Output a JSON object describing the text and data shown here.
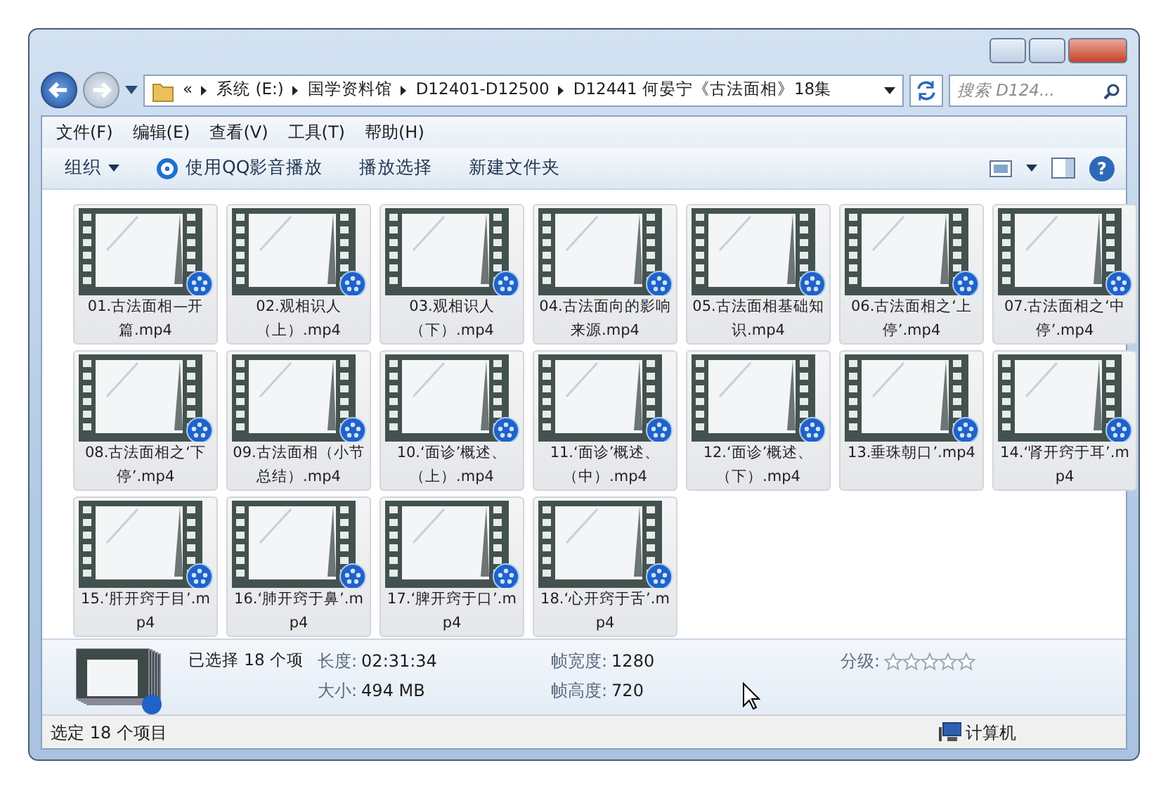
{
  "address": {
    "overflow_mark": "«",
    "segments": [
      "系统 (E:)",
      "国学资料馆",
      "D12401-D12500",
      "D12441 何晏宁《古法面相》18集"
    ]
  },
  "search": {
    "placeholder": "搜索 D124..."
  },
  "menu": [
    "文件(F)",
    "编辑(E)",
    "查看(V)",
    "工具(T)",
    "帮助(H)"
  ],
  "toolbar": [
    {
      "label": "组织",
      "kind": "dropdown"
    },
    {
      "label": "使用QQ影音播放",
      "kind": "app"
    },
    {
      "label": "播放选择",
      "kind": "plain"
    },
    {
      "label": "新建文件夹",
      "kind": "plain"
    }
  ],
  "help_mark": "?",
  "files": [
    {
      "name": "01.古法面相—开篇.mp4",
      "selected": true
    },
    {
      "name": "02.观相识人（上）.mp4",
      "selected": true
    },
    {
      "name": "03.观相识人（下）.mp4",
      "selected": true
    },
    {
      "name": "04.古法面向的影响来源.mp4",
      "selected": true
    },
    {
      "name": "05.古法面相基础知识.mp4",
      "selected": true
    },
    {
      "name": "06.古法面相之‘上停’.mp4",
      "selected": true
    },
    {
      "name": "07.古法面相之‘中停’.mp4",
      "selected": true
    },
    {
      "name": "08.古法面相之‘下停’.mp4",
      "selected": true
    },
    {
      "name": "09.古法面相（小节总结）.mp4",
      "selected": true
    },
    {
      "name": "10.‘面诊’概述、（上）.mp4",
      "selected": true
    },
    {
      "name": "11.‘面诊’概述、（中）.mp4",
      "selected": true
    },
    {
      "name": "12.‘面诊’概述、（下）.mp4",
      "selected": true
    },
    {
      "name": "13.垂珠朝口’.mp4",
      "selected": true
    },
    {
      "name": "14.‘肾开窍于耳’.mp4",
      "selected": true
    },
    {
      "name": "15.‘肝开窍于目’.mp4",
      "selected": true
    },
    {
      "name": "16.‘肺开窍于鼻’.mp4",
      "selected": true
    },
    {
      "name": "17.‘脾开窍于口’.mp4",
      "selected": true
    },
    {
      "name": "18.‘心开窍于舌’.mp4",
      "selected": true
    }
  ],
  "details": {
    "summary": "已选择 18 个项",
    "fields": [
      {
        "label": "长度:",
        "value": "02:31:34"
      },
      {
        "label": "大小:",
        "value": "494 MB"
      },
      {
        "label": "帧宽度:",
        "value": "1280"
      },
      {
        "label": "帧高度:",
        "value": "720"
      }
    ],
    "rating": {
      "label": "分级:",
      "stars": 0
    }
  },
  "status_bar": {
    "text": "选定 18 个项目",
    "location": "计算机"
  }
}
